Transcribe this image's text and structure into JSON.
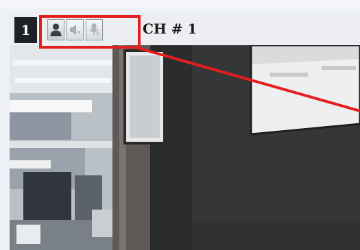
{
  "channel": {
    "number": "1",
    "title": "CH # 1"
  },
  "controls": [
    {
      "name": "person-icon",
      "label": "",
      "state": "active"
    },
    {
      "name": "speaker-icon",
      "label": "",
      "state": "inactive"
    },
    {
      "name": "microphone-icon",
      "label": "",
      "state": "inactive"
    }
  ],
  "colors": {
    "highlight": "#e61e1e",
    "header_bg": "#eceef1",
    "number_bg": "#1d2024"
  }
}
